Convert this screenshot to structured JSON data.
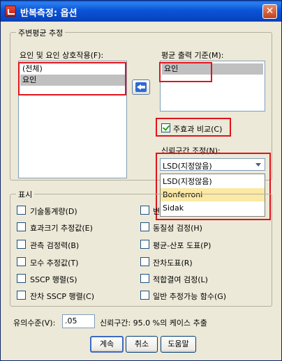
{
  "window": {
    "title": "반복측정: 옵션",
    "close_glyph": "✕"
  },
  "marginal_means": {
    "group_label": "주변평균 추정",
    "factors_label": "요인 및 요인 상호작용(F):",
    "factors_items": [
      "(전체)",
      "요인"
    ],
    "display_label": "평균 출력 기준(M):",
    "display_items": [
      "요인"
    ],
    "compare_label": "주효과 비교(C)",
    "compare_checked": true,
    "ci_adjust_label": "신뢰구간 조정(N):",
    "ci_adjust_value": "LSD(지정않음)",
    "ci_adjust_options": [
      "LSD(지정않음)",
      "Bonferroni",
      "Sidak"
    ],
    "ci_adjust_highlighted": "Bonferroni"
  },
  "display": {
    "group_label": "표시",
    "left_options": [
      {
        "label": "기술통계량(D)",
        "checked": false
      },
      {
        "label": "효과크기 추정값(E)",
        "checked": false
      },
      {
        "label": "관측 검정력(B)",
        "checked": false
      },
      {
        "label": "모수 추정값(T)",
        "checked": false
      },
      {
        "label": "SSCP 행렬(S)",
        "checked": false
      },
      {
        "label": "잔차 SSCP 행렬(C)",
        "checked": false
      }
    ],
    "right_options": [
      {
        "label": "변",
        "checked": false
      },
      {
        "label": "동질성 검정(H)",
        "checked": false
      },
      {
        "label": "평균-산포 도표(P)",
        "checked": false
      },
      {
        "label": "잔차도표(R)",
        "checked": false
      },
      {
        "label": "적합결여 검정(L)",
        "checked": false
      },
      {
        "label": "일반 추정가능 함수(G)",
        "checked": false
      }
    ]
  },
  "significance": {
    "label": "유의수준(V):",
    "value": ".05",
    "ci_text": "신뢰구간: 95.0 %의 케이스 추출"
  },
  "buttons": {
    "continue": "계속",
    "cancel": "취소",
    "help": "도움말"
  }
}
